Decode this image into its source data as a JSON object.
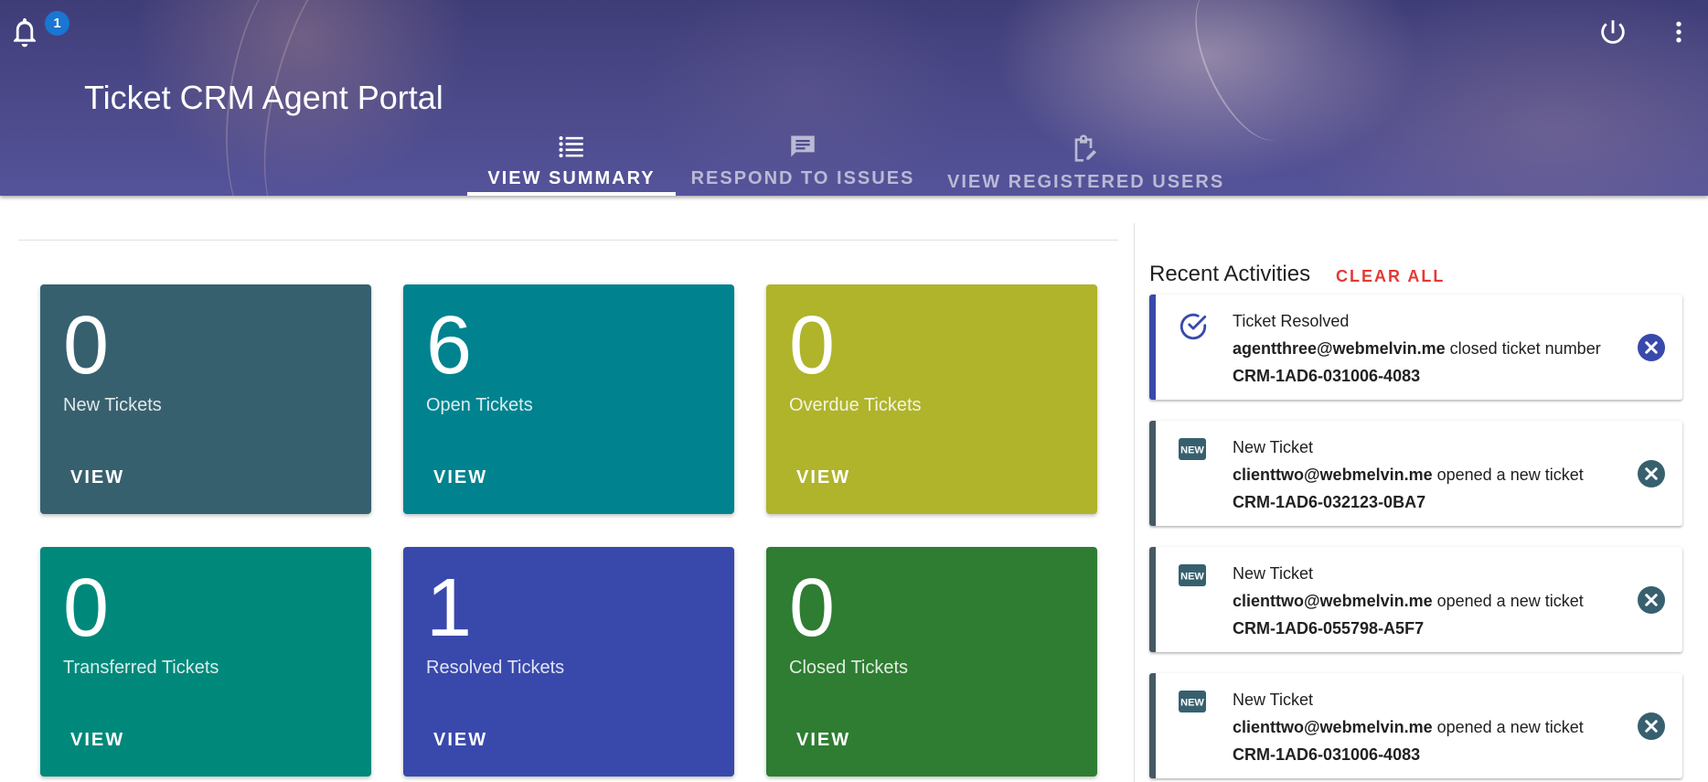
{
  "header": {
    "app_title": "Ticket CRM Agent Portal",
    "notification_count": "1",
    "tabs": [
      {
        "label": "VIEW SUMMARY",
        "icon": "list-icon",
        "active": true
      },
      {
        "label": "RESPOND TO ISSUES",
        "icon": "message-icon",
        "active": false
      },
      {
        "label": "VIEW REGISTERED USERS",
        "icon": "clipboard-edit-icon",
        "active": false
      }
    ]
  },
  "summary": {
    "view_label": "VIEW",
    "cards": [
      {
        "count": "0",
        "label": "New Tickets",
        "color": "#37606f"
      },
      {
        "count": "6",
        "label": "Open Tickets",
        "color": "#00838f"
      },
      {
        "count": "0",
        "label": "Overdue Tickets",
        "color": "#afb42b"
      },
      {
        "count": "0",
        "label": "Transferred Tickets",
        "color": "#00897b"
      },
      {
        "count": "1",
        "label": "Resolved Tickets",
        "color": "#3949ab"
      },
      {
        "count": "0",
        "label": "Closed Tickets",
        "color": "#2e7d32"
      }
    ]
  },
  "activities": {
    "title": "Recent Activities",
    "clear_label": "CLEAR ALL",
    "items": [
      {
        "icon": "check-circle-icon",
        "title": "Ticket Resolved",
        "user": "agentthree@webmelvin.me",
        "action": " closed ticket number",
        "ticket": "CRM-1AD6-031006-4083",
        "accent": "#3949ab"
      },
      {
        "icon": "new-badge-icon",
        "title": "New Ticket",
        "user": "clienttwo@webmelvin.me",
        "action": " opened a new ticket",
        "ticket": "CRM-1AD6-032123-0BA7",
        "accent": "#37606f"
      },
      {
        "icon": "new-badge-icon",
        "title": "New Ticket",
        "user": "clienttwo@webmelvin.me",
        "action": " opened a new ticket",
        "ticket": "CRM-1AD6-055798-A5F7",
        "accent": "#37606f"
      },
      {
        "icon": "new-badge-icon",
        "title": "New Ticket",
        "user": "clienttwo@webmelvin.me",
        "action": " opened a new ticket",
        "ticket": "CRM-1AD6-031006-4083",
        "accent": "#37606f"
      }
    ]
  }
}
